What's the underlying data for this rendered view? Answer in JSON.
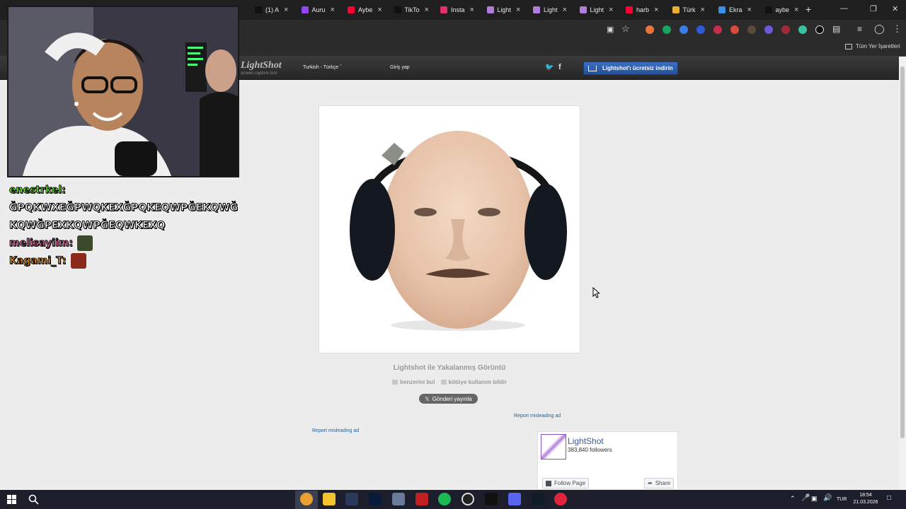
{
  "browser": {
    "tabs": [
      {
        "label": "(1) A",
        "icon": "tiktok-icon",
        "color": "#111111"
      },
      {
        "label": "Auru",
        "icon": "twitch-icon",
        "color": "#9146ff"
      },
      {
        "label": "Aybe",
        "icon": "youtube-icon",
        "color": "#ff0033"
      },
      {
        "label": "TikTo",
        "icon": "tiktok-icon",
        "color": "#111111"
      },
      {
        "label": "Insta",
        "icon": "instagram-icon",
        "color": "#e1306c"
      },
      {
        "label": "Light",
        "icon": "lightshot-icon",
        "color": "#b07ed8"
      },
      {
        "label": "Light",
        "icon": "lightshot-icon",
        "color": "#b07ed8"
      },
      {
        "label": "Light",
        "icon": "lightshot-icon",
        "color": "#b07ed8"
      },
      {
        "label": "harb",
        "icon": "youtube-icon",
        "color": "#ff0033"
      },
      {
        "label": "Türk",
        "icon": "globe-icon",
        "color": "#e8b030"
      },
      {
        "label": "Ekra",
        "icon": "cloud-icon",
        "color": "#3b8fe8"
      },
      {
        "label": "aybe",
        "icon": "tiktok-icon",
        "color": "#111111"
      }
    ],
    "new_tab": "+",
    "bookmarks_all": "Tüm Yer İşaretleri"
  },
  "lightshot": {
    "logo": "LightShot",
    "tagline": "screen capture tool",
    "language": "Turkish - Türkçe",
    "login": "Giriş yap",
    "download": "Lightshot'ı ücretsiz indirin",
    "caption": "Lightshot ile Yakalanmış Görüntü",
    "find_similar": "benzerini bul",
    "report_abuse": "kötüye kullanım bildir",
    "tweet": "Gönderi yayınla",
    "report_ad_1": "Report misleading ad",
    "report_ad_2": "Report misleading ad"
  },
  "facebook_widget": {
    "page_name": "LightShot",
    "followers": "383,840 followers",
    "follow": "Follow Page",
    "share": "Share"
  },
  "stream_chat": [
    {
      "user": "enestrkel:",
      "color": "#7cff3a",
      "text": ""
    },
    {
      "user": "",
      "color": "#ffffff",
      "text": "ĞPQKWXEĞPWQKEXĞPQKEQWPĞEKQWĞ"
    },
    {
      "user": "",
      "color": "#ffffff",
      "text": "KQWĞPEXKQWPĞEQWKEXQ"
    },
    {
      "user": "melisayiim:",
      "color": "#ff6eb0",
      "text": ""
    },
    {
      "user": "Kagami_T:",
      "color": "#ff9a1a",
      "text": ""
    }
  ],
  "taskbar": {
    "lang": "TUR",
    "time": "18:54",
    "date": "21.03.2026"
  }
}
